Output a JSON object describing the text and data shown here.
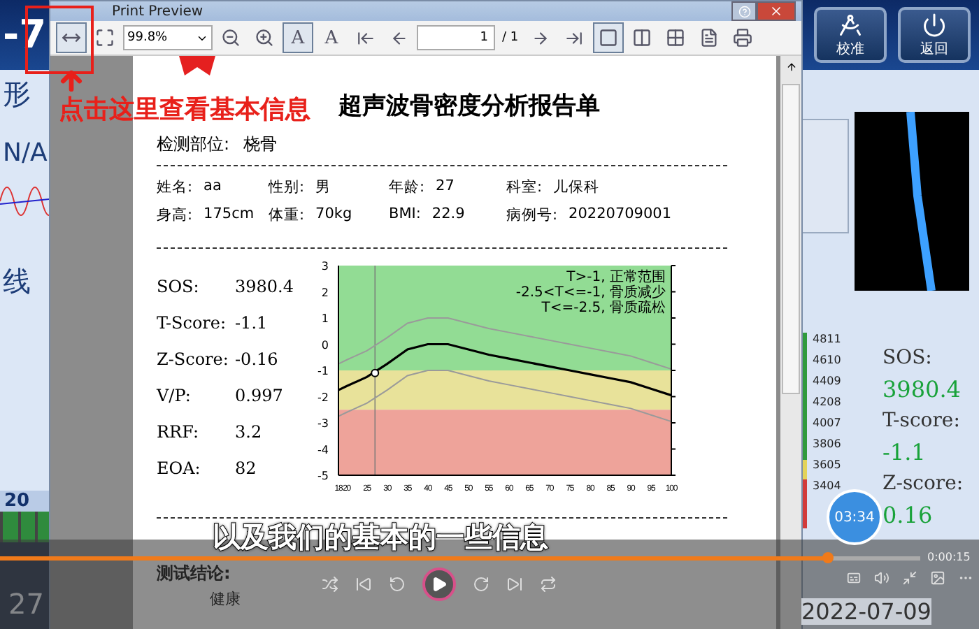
{
  "background_app": {
    "header_value": "-7",
    "left_labels": [
      "形",
      "N/A",
      "线"
    ],
    "left_scale_label": "20",
    "left_bottom_label": "27",
    "buttons": [
      {
        "label": "校准"
      },
      {
        "label": "返回"
      }
    ],
    "gauge_ticks": [
      "4811",
      "4610",
      "4409",
      "4208",
      "4007",
      "3806",
      "3605",
      "3404"
    ],
    "readings": [
      {
        "label": "SOS:",
        "value": "3980.4"
      },
      {
        "label": "T-score:",
        "value": "-1.1"
      },
      {
        "label": "Z-score:",
        "value": "0.16"
      }
    ],
    "date": "2022-07-09"
  },
  "print_preview": {
    "title": "Print Preview",
    "toolbar": {
      "zoom": "99.8%",
      "text_buttons": [
        "A",
        "A"
      ],
      "page": "1",
      "page_total": "/ 1",
      "view_modes": [
        {
          "selected": true
        },
        {
          "selected": false
        },
        {
          "selected": false
        }
      ]
    },
    "report": {
      "title": "超声波骨密度分析报告单",
      "site_label": "检测部位:",
      "site_value": "桡骨",
      "patient_fields": [
        {
          "label": "姓名:",
          "value": "aa"
        },
        {
          "label": "性别:",
          "value": "男"
        },
        {
          "label": "年龄:",
          "value": "27"
        },
        {
          "label": "科室:",
          "value": "儿保科"
        },
        {
          "label": "身高:",
          "value": "175cm"
        },
        {
          "label": "体重:",
          "value": "70kg"
        },
        {
          "label": "BMI:",
          "value": "22.9"
        },
        {
          "label": "病例号:",
          "value": "20220709001"
        }
      ],
      "metrics": [
        {
          "label": "SOS:",
          "value": "3980.4"
        },
        {
          "label": "T-Score:",
          "value": "-1.1"
        },
        {
          "label": "Z-Score:",
          "value": "-0.16"
        },
        {
          "label": "V/P:",
          "value": "0.997"
        },
        {
          "label": "RRF:",
          "value": "3.2"
        },
        {
          "label": "EOA:",
          "value": "82"
        }
      ],
      "chart_data": {
        "type": "line",
        "x": [
          18,
          20,
          25,
          27,
          30,
          35,
          40,
          45,
          50,
          55,
          60,
          65,
          70,
          75,
          80,
          85,
          90,
          95,
          100
        ],
        "xticks": [
          18,
          20,
          25,
          30,
          35,
          40,
          45,
          50,
          55,
          60,
          65,
          70,
          75,
          80,
          85,
          90,
          95,
          100
        ],
        "yticks": [
          3,
          2,
          1,
          0,
          -1,
          -2,
          -3,
          -4,
          -5
        ],
        "xlim": [
          18,
          100
        ],
        "ylim": [
          -5,
          3
        ],
        "series": [
          {
            "color": "#9a9a9a",
            "values": [
              -0.75,
              -0.6,
              -0.25,
              -0.05,
              0.25,
              0.8,
              1,
              1,
              0.8,
              0.6,
              0.45,
              0.3,
              0.15,
              0,
              -0.15,
              -0.3,
              -0.45,
              -0.7,
              -0.95
            ]
          },
          {
            "color": "#000000",
            "values": [
              -1.75,
              -1.6,
              -1.25,
              -1.05,
              -0.75,
              -0.2,
              0,
              0,
              -0.2,
              -0.4,
              -0.55,
              -0.7,
              -0.85,
              -1,
              -1.15,
              -1.3,
              -1.45,
              -1.7,
              -1.95
            ]
          },
          {
            "color": "#9a9a9a",
            "values": [
              -2.75,
              -2.6,
              -2.25,
              -2.05,
              -1.75,
              -1.2,
              -1,
              -1,
              -1.2,
              -1.4,
              -1.55,
              -1.7,
              -1.85,
              -2,
              -2.15,
              -2.3,
              -2.45,
              -2.7,
              -2.95
            ]
          },
          {
            "color": "#000000",
            "marker": true,
            "values": [
              null,
              null,
              null,
              -1.1,
              null,
              null,
              null,
              null,
              null,
              null,
              null,
              null,
              null,
              null,
              null,
              null,
              null,
              null,
              null
            ]
          }
        ],
        "bands": [
          {
            "axis": "y",
            "from": -1,
            "to": 3,
            "color": "#92dc94"
          },
          {
            "axis": "y",
            "from": -2.5,
            "to": -1,
            "color": "#e8e29a"
          },
          {
            "axis": "y",
            "from": -5,
            "to": -2.5,
            "color": "#eea39a"
          }
        ],
        "ref_lines": [
          {
            "axis": "x",
            "value": 27
          }
        ],
        "annotations": [
          "T>-1, 正常范围",
          "-2.5<T<=-1, 骨质减少",
          "T<=-2.5, 骨质疏松"
        ]
      },
      "conclusion_label": "测试结论:",
      "conclusion": "健康"
    }
  },
  "annotation": {
    "text": "点击这里查看基本信息"
  },
  "player": {
    "subtitle": "以及我们的基本的一些信息",
    "progress": {
      "level": 0.9
    },
    "time": "0:00:15",
    "bubble_time": "03:34"
  }
}
